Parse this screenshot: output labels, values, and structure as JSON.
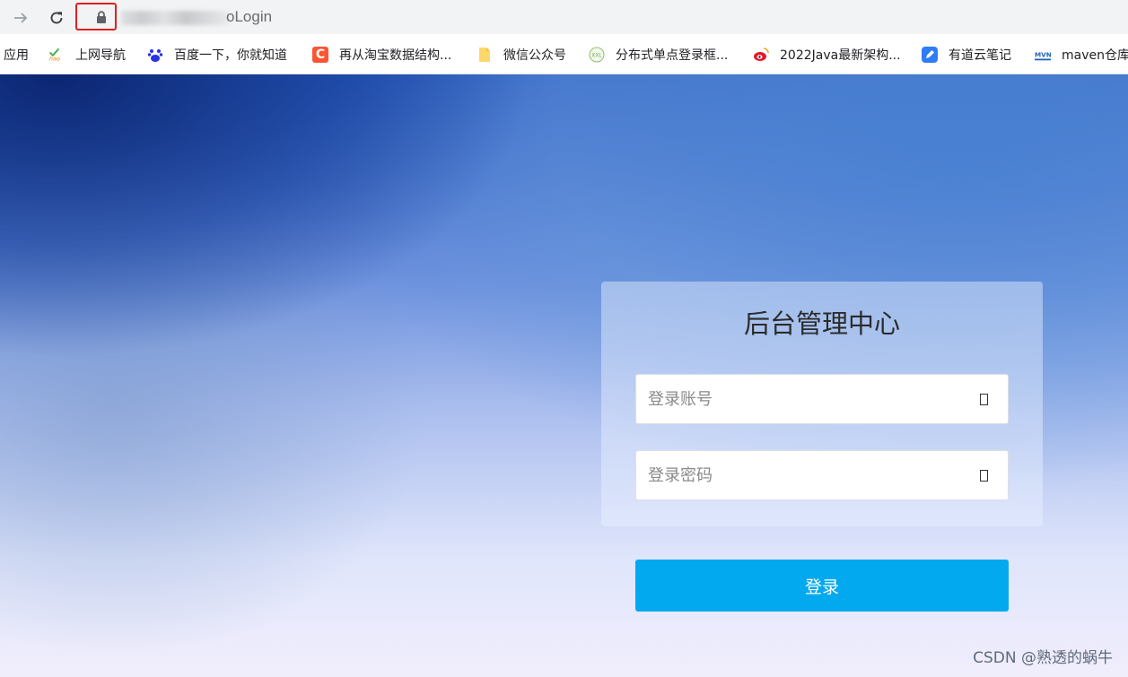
{
  "browser": {
    "url_visible_text": "oLogin",
    "bookmarks": [
      {
        "label": "应用",
        "icon": "apps-icon"
      },
      {
        "label": "上网导航",
        "icon": "hao-icon",
        "icon_text": "hao"
      },
      {
        "label": "百度一下，你就知道",
        "icon": "baidu-paw-icon"
      },
      {
        "label": "再从淘宝数据结构...",
        "icon": "csdn-c-icon",
        "icon_text": "C"
      },
      {
        "label": "微信公众号",
        "icon": "folder-icon"
      },
      {
        "label": "分布式单点登录框...",
        "icon": "xxl-icon",
        "icon_text": "XXL"
      },
      {
        "label": "2022Java最新架构...",
        "icon": "weibo-icon"
      },
      {
        "label": "有道云笔记",
        "icon": "youdao-note-icon"
      },
      {
        "label": "maven仓库",
        "icon": "mvn-icon",
        "icon_text": "MVN"
      }
    ]
  },
  "login": {
    "title": "后台管理中心",
    "account_placeholder": "登录账号",
    "password_placeholder": "登录密码",
    "submit_label": "登录"
  },
  "watermark": "CSDN @熟透的蜗牛",
  "colors": {
    "accent": "#03a9ee",
    "highlight_box": "#e02020"
  }
}
